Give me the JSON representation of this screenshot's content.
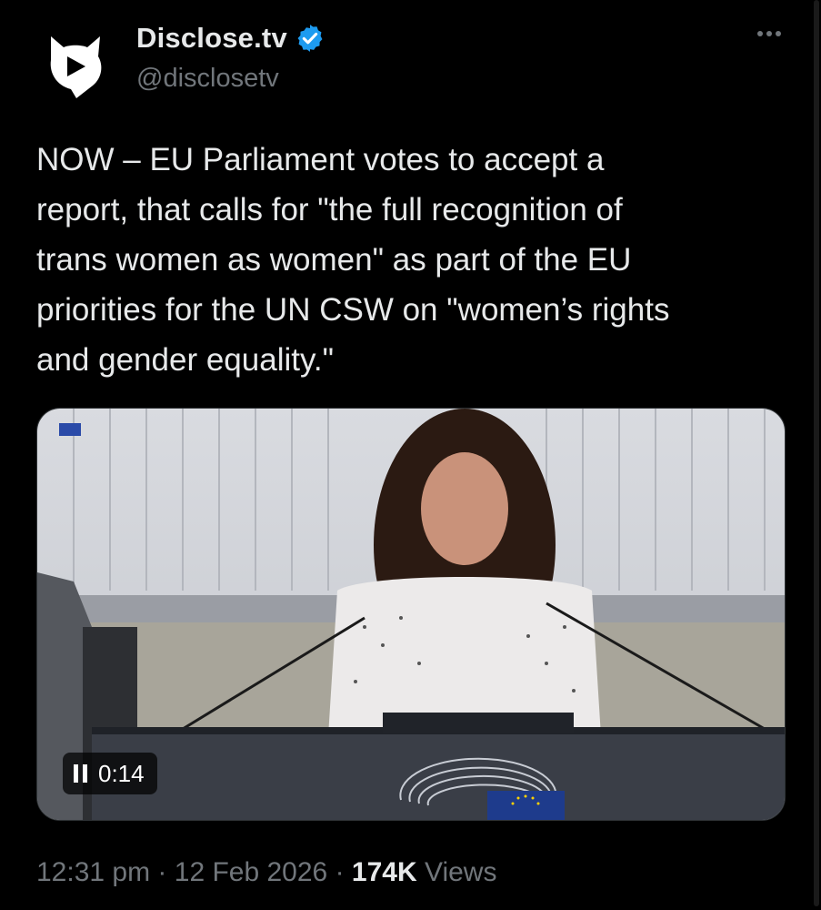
{
  "author": {
    "display_name": "Disclose.tv",
    "handle": "@disclosetv",
    "avatar_icon": "disclose-tv-logo-icon",
    "verified_icon": "verified-badge-icon",
    "verified_color": "#1d9bf0"
  },
  "menu": {
    "icon": "more-options-icon"
  },
  "tweet": {
    "text": "NOW – EU Parliament votes to accept a\nreport, that calls for \"the full recognition of\ntrans women as women\" as part of the EU\npriorities for the UN CSW on \"women’s rights\nand gender equality.\""
  },
  "video": {
    "control_icon": "pause-icon",
    "elapsed": "0:14"
  },
  "meta": {
    "time": "12:31 pm",
    "separator": " · ",
    "date": "12 Feb 2026",
    "views_count": "174K",
    "views_label": " Views"
  },
  "colors": {
    "background": "#000000",
    "text_primary": "#e7e9ea",
    "text_secondary": "#71767b",
    "verified": "#1d9bf0"
  }
}
